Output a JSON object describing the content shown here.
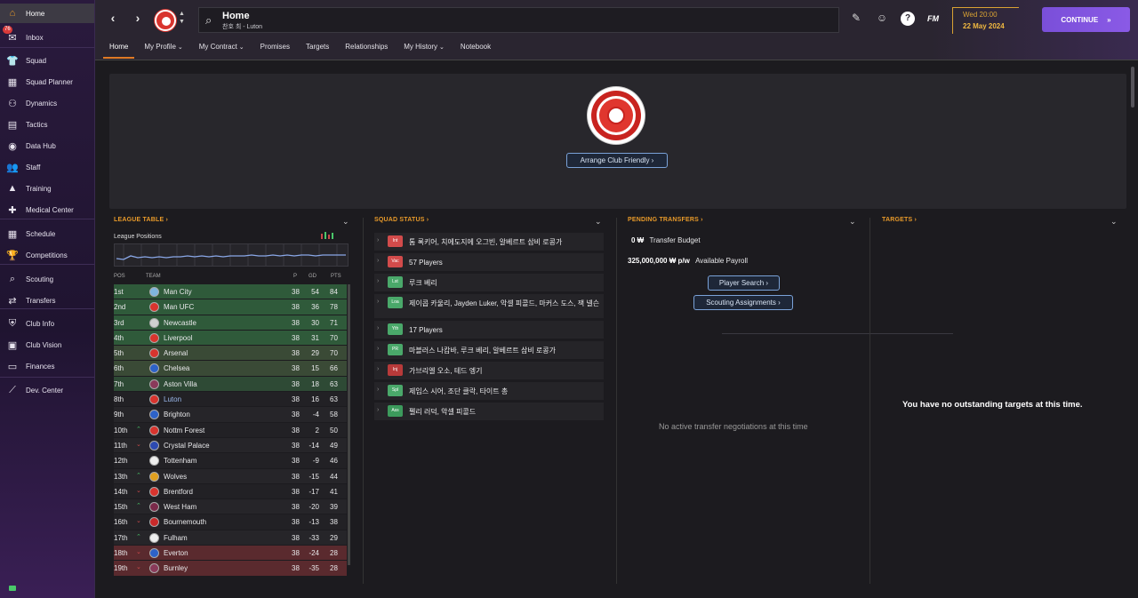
{
  "sidebar": {
    "items": [
      {
        "label": "Home",
        "icon": "home-icon",
        "glyph": "⌂"
      },
      {
        "label": "Inbox",
        "icon": "inbox-icon",
        "glyph": "✉",
        "badge": "76"
      },
      {
        "label": "Squad",
        "icon": "shirt-icon",
        "glyph": "👕"
      },
      {
        "label": "Squad Planner",
        "icon": "planner-icon",
        "glyph": "▦"
      },
      {
        "label": "Dynamics",
        "icon": "dynamics-icon",
        "glyph": "⚇"
      },
      {
        "label": "Tactics",
        "icon": "tactics-icon",
        "glyph": "▤"
      },
      {
        "label": "Data Hub",
        "icon": "data-hub-icon",
        "glyph": "◉"
      },
      {
        "label": "Staff",
        "icon": "staff-icon",
        "glyph": "👥"
      },
      {
        "label": "Training",
        "icon": "training-icon",
        "glyph": "▲"
      },
      {
        "label": "Medical Center",
        "icon": "medical-icon",
        "glyph": "✚"
      },
      {
        "label": "Schedule",
        "icon": "calendar-icon",
        "glyph": "▦"
      },
      {
        "label": "Competitions",
        "icon": "trophy-icon",
        "glyph": "🏆"
      },
      {
        "label": "Scouting",
        "icon": "scouting-icon",
        "glyph": "⌕"
      },
      {
        "label": "Transfers",
        "icon": "transfers-icon",
        "glyph": "⇄"
      },
      {
        "label": "Club Info",
        "icon": "shield-icon",
        "glyph": "⛨"
      },
      {
        "label": "Club Vision",
        "icon": "vision-icon",
        "glyph": "▣"
      },
      {
        "label": "Finances",
        "icon": "finances-icon",
        "glyph": "▭"
      },
      {
        "label": "Dev. Center",
        "icon": "dev-center-icon",
        "glyph": "⟋"
      }
    ],
    "footer_icon": "status-icon"
  },
  "header": {
    "title": "Home",
    "subtitle": "찬호 최 - Luton",
    "date_time": "Wed 20:00",
    "date_day": "22 May 2024",
    "fm_label": "FM",
    "continue_label": "CONTINUE",
    "continue_icon": "»",
    "tabs": [
      {
        "label": "Home"
      },
      {
        "label": "My Profile",
        "dropdown": true
      },
      {
        "label": "My Contract",
        "dropdown": true
      },
      {
        "label": "Promises"
      },
      {
        "label": "Targets"
      },
      {
        "label": "Relationships"
      },
      {
        "label": "My History",
        "dropdown": true
      },
      {
        "label": "Notebook"
      }
    ]
  },
  "hero": {
    "button_label": "Arrange Club Friendly ›"
  },
  "league_table": {
    "heading": "LEAGUE TABLE ›",
    "subheading": "League Positions",
    "columns": {
      "pos": "POS",
      "team": "TEAM",
      "p": "P",
      "gd": "GD",
      "pts": "PTS"
    },
    "rows": [
      {
        "pos": "1st",
        "move": "",
        "team": "Man City",
        "p": "38",
        "gd": "54",
        "pts": "84",
        "zone": "cl",
        "crest": "#7fb5de"
      },
      {
        "pos": "2nd",
        "move": "",
        "team": "Man UFC",
        "p": "38",
        "gd": "36",
        "pts": "78",
        "zone": "cl",
        "crest": "#d8342e"
      },
      {
        "pos": "3rd",
        "move": "",
        "team": "Newcastle",
        "p": "38",
        "gd": "30",
        "pts": "71",
        "zone": "cl",
        "crest": "#cfcfcf"
      },
      {
        "pos": "4th",
        "move": "",
        "team": "Liverpool",
        "p": "38",
        "gd": "31",
        "pts": "70",
        "zone": "cl",
        "crest": "#d8342e"
      },
      {
        "pos": "5th",
        "move": "",
        "team": "Arsenal",
        "p": "38",
        "gd": "29",
        "pts": "70",
        "zone": "el",
        "crest": "#d8342e"
      },
      {
        "pos": "6th",
        "move": "",
        "team": "Chelsea",
        "p": "38",
        "gd": "15",
        "pts": "66",
        "zone": "el",
        "crest": "#2d62c8"
      },
      {
        "pos": "7th",
        "move": "",
        "team": "Aston Villa",
        "p": "38",
        "gd": "18",
        "pts": "63",
        "zone": "ecl",
        "crest": "#8a3a5a"
      },
      {
        "pos": "8th",
        "move": "",
        "team": "Luton",
        "p": "38",
        "gd": "16",
        "pts": "63",
        "zone": "",
        "crest": "#d8342e",
        "highlight": true
      },
      {
        "pos": "9th",
        "move": "",
        "team": "Brighton",
        "p": "38",
        "gd": "-4",
        "pts": "58",
        "zone": "",
        "crest": "#2d62c8"
      },
      {
        "pos": "10th",
        "move": "up",
        "team": "Nottm Forest",
        "p": "38",
        "gd": "2",
        "pts": "50",
        "zone": "",
        "crest": "#d8342e"
      },
      {
        "pos": "11th",
        "move": "down",
        "team": "Crystal Palace",
        "p": "38",
        "gd": "-14",
        "pts": "49",
        "zone": "",
        "crest": "#2d4ab0"
      },
      {
        "pos": "12th",
        "move": "",
        "team": "Tottenham",
        "p": "38",
        "gd": "-9",
        "pts": "46",
        "zone": "",
        "crest": "#eeeeee"
      },
      {
        "pos": "13th",
        "move": "up",
        "team": "Wolves",
        "p": "38",
        "gd": "-15",
        "pts": "44",
        "zone": "",
        "crest": "#e0a020"
      },
      {
        "pos": "14th",
        "move": "down",
        "team": "Brentford",
        "p": "38",
        "gd": "-17",
        "pts": "41",
        "zone": "",
        "crest": "#d8342e"
      },
      {
        "pos": "15th",
        "move": "up",
        "team": "West Ham",
        "p": "38",
        "gd": "-20",
        "pts": "39",
        "zone": "",
        "crest": "#7a2a4a"
      },
      {
        "pos": "16th",
        "move": "down",
        "team": "Bournemouth",
        "p": "38",
        "gd": "-13",
        "pts": "38",
        "zone": "",
        "crest": "#c82a2a"
      },
      {
        "pos": "17th",
        "move": "up",
        "team": "Fulham",
        "p": "38",
        "gd": "-33",
        "pts": "29",
        "zone": "",
        "crest": "#eeeeee"
      },
      {
        "pos": "18th",
        "move": "down",
        "team": "Everton",
        "p": "38",
        "gd": "-24",
        "pts": "28",
        "zone": "rel",
        "crest": "#2d62c8"
      },
      {
        "pos": "19th",
        "move": "down",
        "team": "Burnley",
        "p": "38",
        "gd": "-35",
        "pts": "28",
        "zone": "rel",
        "crest": "#8a3a5a"
      }
    ]
  },
  "squad_status": {
    "heading": "SQUAD STATUS ›",
    "rows": [
      {
        "tag": "Int",
        "color": "#d24b4b",
        "text": "톰 록키어, 치에도지에 오그빈, 알베르트 삼비 로콩가"
      },
      {
        "tag": "Vac",
        "color": "#d24b4b",
        "text": "57 Players"
      },
      {
        "tag": "Lst",
        "color": "#4aa86a",
        "text": "루크 베리"
      },
      {
        "tag": "Loa",
        "color": "#4aa86a",
        "text": "제이콥 카울리, Jayden Luker, 악셀 피콜드, 마커스 도스, 잭 넬슨"
      },
      {
        "tag": "Yth",
        "color": "#4aa86a",
        "text": "17 Players"
      },
      {
        "tag": "PR",
        "color": "#4aa86a",
        "text": "마블러스 나캄바, 루크 베리, 알베르트 삼비 로콩가"
      },
      {
        "tag": "Inj",
        "color": "#b83a3a",
        "text": "가브리엘 오소, 테드 엥기"
      },
      {
        "tag": "Spl",
        "color": "#4aa86a",
        "text": "제임스 시어, 조단 클락, 타이트 총"
      },
      {
        "tag": "Ass",
        "color": "#3c9a5c",
        "text": "펠리 러덕, 악셀 피콜드"
      }
    ]
  },
  "pending_transfers": {
    "heading": "PENDING TRANSFERS ›",
    "budget_value": "0 ₩",
    "budget_label": "Transfer Budget",
    "payroll_value": "325,000,000 ₩ p/w",
    "payroll_label": "Available Payroll",
    "player_search_label": "Player Search ›",
    "scouting_label": "Scouting Assignments ›",
    "empty_message": "No active transfer negotiations at this time"
  },
  "targets": {
    "heading": "TARGETS ›",
    "empty_message": "You have no outstanding targets at this time."
  },
  "colors": {
    "accent_orange": "#e89a2a",
    "continue_purple": "#7a4fd9",
    "zone_cl": "#2f5a3a",
    "zone_el": "#3a4a36",
    "zone_ecl": "#2e4a35",
    "zone_rel": "#5a2a2e"
  }
}
